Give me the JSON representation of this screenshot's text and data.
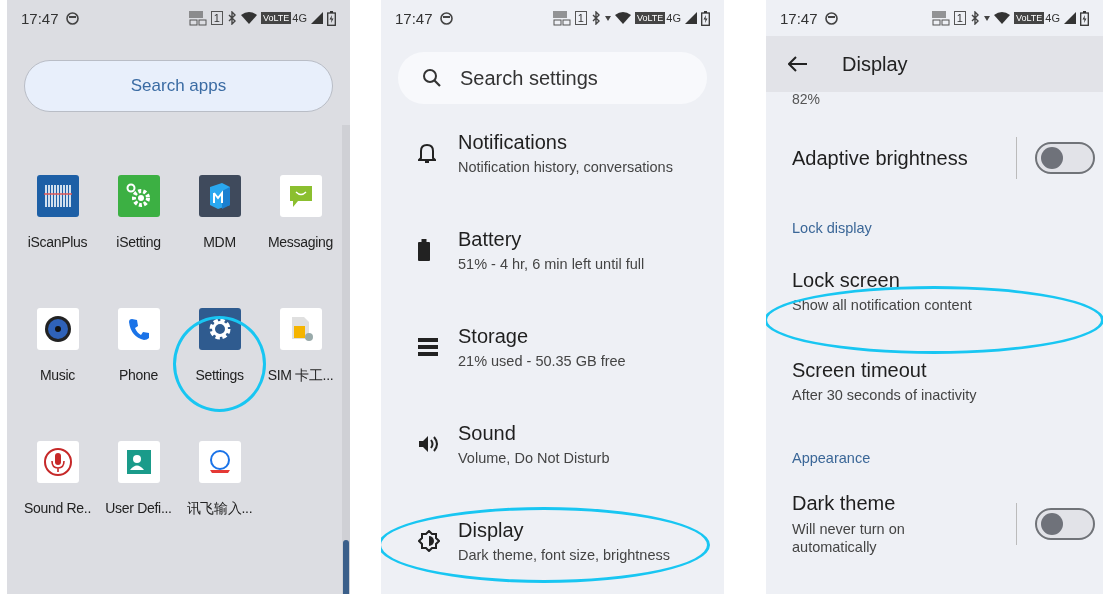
{
  "app_drawer": {
    "status_bar": {
      "time": "17:47",
      "sim": "1",
      "volte": "VoLTE",
      "network": "4G"
    },
    "search": {
      "placeholder": "Search apps"
    },
    "apps": [
      {
        "label": "iScanPlus",
        "highlighted": false
      },
      {
        "label": "iSetting",
        "highlighted": false
      },
      {
        "label": "MDM",
        "highlighted": false
      },
      {
        "label": "Messaging",
        "highlighted": false
      },
      {
        "label": "Music",
        "highlighted": false
      },
      {
        "label": "Phone",
        "highlighted": false
      },
      {
        "label": "Settings",
        "highlighted": true
      },
      {
        "label": "SIM 卡工...",
        "highlighted": false
      },
      {
        "label": "Sound Re..",
        "highlighted": false
      },
      {
        "label": "User Defi...",
        "highlighted": false
      },
      {
        "label": "讯飞输入...",
        "highlighted": false
      }
    ]
  },
  "settings": {
    "status_bar": {
      "time": "17:47",
      "sim": "1",
      "volte": "VoLTE",
      "network": "4G"
    },
    "search": {
      "placeholder": "Search settings"
    },
    "items": [
      {
        "title": "Notifications",
        "summary": "Notification history, conversations",
        "highlighted": false
      },
      {
        "title": "Battery",
        "summary": "51% - 4 hr, 6 min left until full",
        "highlighted": false
      },
      {
        "title": "Storage",
        "summary": "21% used - 50.35 GB free",
        "highlighted": false
      },
      {
        "title": "Sound",
        "summary": "Volume, Do Not Disturb",
        "highlighted": false
      },
      {
        "title": "Display",
        "summary": "Dark theme, font size, brightness",
        "highlighted": true
      }
    ]
  },
  "display_settings": {
    "status_bar": {
      "time": "17:47",
      "sim": "1",
      "volte": "VoLTE",
      "network": "4G"
    },
    "header": {
      "title": "Display"
    },
    "rows": [
      {
        "kind": "value",
        "text": "82%"
      },
      {
        "kind": "toggle",
        "title": "Adaptive brightness",
        "on": false
      },
      {
        "kind": "section",
        "text": "Lock display"
      },
      {
        "kind": "item",
        "title": "Lock screen",
        "summary": "Show all notification content",
        "highlighted": true
      },
      {
        "kind": "item",
        "title": "Screen timeout",
        "summary": "After 30 seconds of inactivity",
        "highlighted": false
      },
      {
        "kind": "section",
        "text": "Appearance"
      },
      {
        "kind": "toggle",
        "title": "Dark theme",
        "summary": "Will never turn on automatically",
        "on": false
      }
    ]
  }
}
